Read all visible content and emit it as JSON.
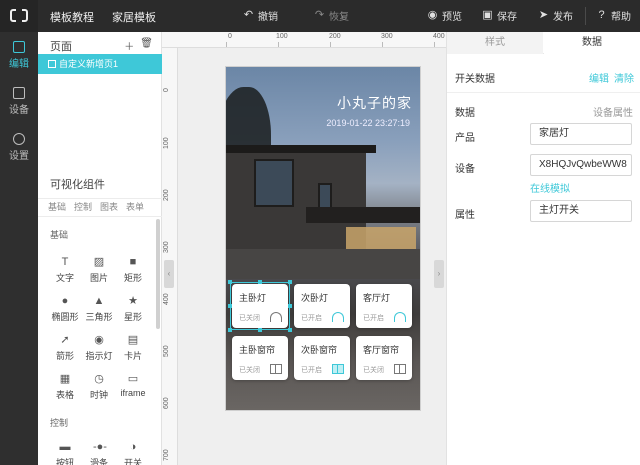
{
  "topbar": {
    "menu1": "模板教程",
    "menu2": "家居模板",
    "undo": "撤销",
    "redo": "恢复",
    "preview": "预览",
    "save": "保存",
    "publish": "发布",
    "help": "帮助"
  },
  "rail": {
    "edit": "编辑",
    "device": "设备",
    "settings": "设置"
  },
  "pages": {
    "header": "页面",
    "items": [
      "自定义新增页1"
    ]
  },
  "components": {
    "title": "可视化组件",
    "tabs": [
      "基础",
      "控制",
      "图表",
      "表单"
    ],
    "basic_label": "基础",
    "basic": [
      "文字",
      "图片",
      "矩形",
      "椭圆形",
      "三角形",
      "星形",
      "箭形",
      "指示灯",
      "卡片",
      "表格",
      "时钟",
      "iframe"
    ],
    "control_label": "控制",
    "control": [
      "按钮",
      "滑条",
      "开关"
    ]
  },
  "ruler": {
    "top": [
      "0",
      "100",
      "200",
      "300",
      "400"
    ],
    "left": [
      "0",
      "100",
      "200",
      "300",
      "400",
      "500",
      "600",
      "700"
    ]
  },
  "preview": {
    "title": "小丸子的家",
    "datetime": "2019-01-22 23:27:19",
    "tiles": [
      {
        "name": "主卧灯",
        "state": "已关闭"
      },
      {
        "name": "次卧灯",
        "state": "已开启"
      },
      {
        "name": "客厅灯",
        "state": "已开启"
      },
      {
        "name": "主卧窗帘",
        "state": "已关闭"
      },
      {
        "name": "次卧窗帘",
        "state": "已开启"
      },
      {
        "name": "客厅窗帘",
        "state": "已关闭"
      }
    ]
  },
  "props": {
    "tab_style": "样式",
    "tab_data": "数据",
    "switch_data": "开关数据",
    "edit": "编辑",
    "clear": "清除",
    "data_label": "数据",
    "device_attr": "设备属性",
    "product_label": "产品",
    "product_value": "家居灯",
    "device_label": "设备",
    "device_value": "X8HQJvQwbeWW8",
    "simulate": "在线模拟",
    "attr_label": "属性",
    "attr_value": "主灯开关"
  },
  "colors": {
    "accent": "#3ec8d8",
    "topbar": "#2b2b2b"
  }
}
